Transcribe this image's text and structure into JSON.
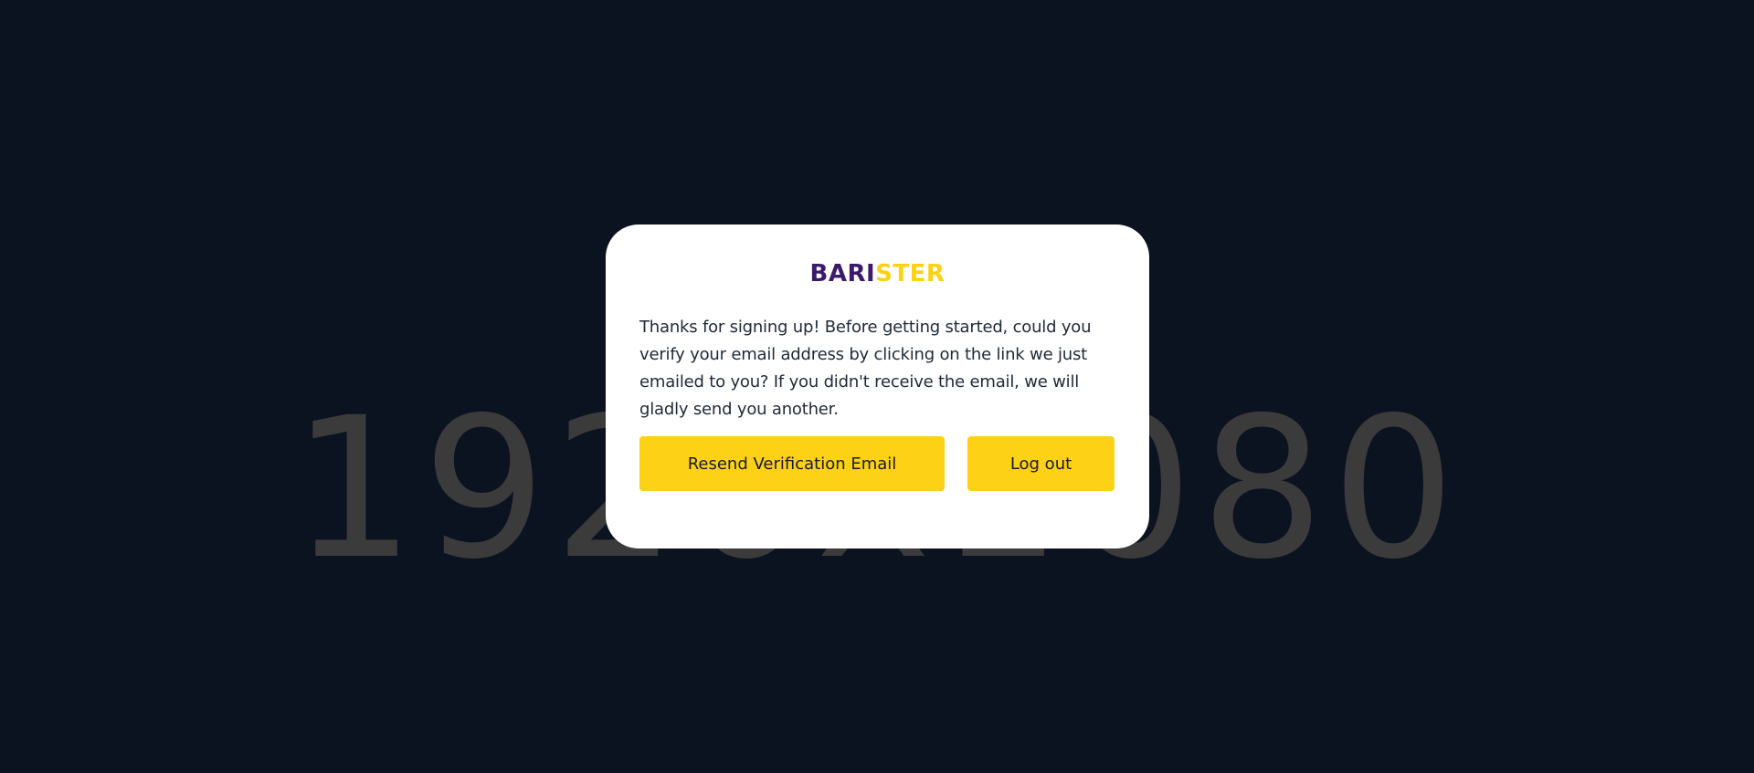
{
  "background": {
    "placeholder_text": "1920x1080",
    "color": "#0c1320"
  },
  "dialog": {
    "logo": {
      "part1": "BARI",
      "part2": "STER",
      "colors": {
        "part1": "#3b1a6b",
        "part2": "#fcd116"
      }
    },
    "message": "Thanks for signing up! Before getting started, could you verify your email address by clicking on the link we just emailed to you? If you didn't receive the email, we will gladly send you another.",
    "buttons": {
      "resend_label": "Resend Verification Email",
      "logout_label": "Log out"
    },
    "accent_color": "#fcd116"
  }
}
